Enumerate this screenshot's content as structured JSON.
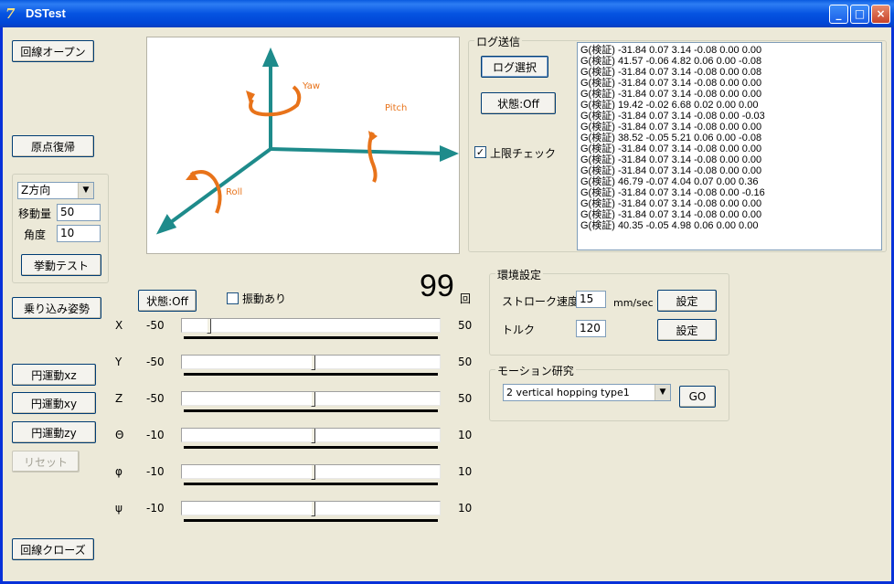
{
  "window": {
    "title": "DSTest",
    "icon_glyph": "7",
    "min": "_",
    "max": "□",
    "close": "×"
  },
  "left": {
    "open_line": "回線オープン",
    "origin_reset": "原点復帰",
    "direction": "Z方向",
    "move_label": "移動量",
    "move_value": "50",
    "angle_label": "角度",
    "angle_value": "10",
    "behavior_test": "挙動テスト",
    "boarding_pose": "乗り込み姿勢",
    "circle_xz": "円運動xz",
    "circle_xy": "円運動xy",
    "circle_zy": "円運動zy",
    "reset": "リセット",
    "close_line": "回線クローズ"
  },
  "axes3d": {
    "yaw": "Yaw",
    "pitch": "Pitch",
    "roll": "Roll"
  },
  "log_panel": {
    "legend": "ログ送信",
    "select_log": "ログ選択",
    "state": "状態:Off",
    "limit_check": "上限チェック",
    "lines": [
      "G(検証) -31.84 0.07 3.14 -0.08 0.00 0.00",
      "G(検証) 41.57 -0.06 4.82 0.06 0.00 -0.08",
      "G(検証) -31.84 0.07 3.14 -0.08 0.00 0.08",
      "G(検証) -31.84 0.07 3.14 -0.08 0.00 0.00",
      "G(検証) -31.84 0.07 3.14 -0.08 0.00 0.00",
      "G(検証) 19.42 -0.02 6.68 0.02 0.00 0.00",
      "G(検証) -31.84 0.07 3.14 -0.08 0.00 -0.03",
      "G(検証) -31.84 0.07 3.14 -0.08 0.00 0.00",
      "G(検証) 38.52 -0.05 5.21 0.06 0.00 -0.08",
      "G(検証) -31.84 0.07 3.14 -0.08 0.00 0.00",
      "G(検証) -31.84 0.07 3.14 -0.08 0.00 0.00",
      "G(検証) -31.84 0.07 3.14 -0.08 0.00 0.00",
      "G(検証) 46.79 -0.07 4.04 0.07 0.00 0.36",
      "G(検証) -31.84 0.07 3.14 -0.08 0.00 -0.16",
      "G(検証) -31.84 0.07 3.14 -0.08 0.00 0.00",
      "G(検証) -31.84 0.07 3.14 -0.08 0.00 0.00",
      "G(検証) 40.35 -0.05 4.98 0.06 0.00 0.00"
    ]
  },
  "controls": {
    "state": "状態:Off",
    "vibration": "振動あり",
    "count": "99",
    "count_unit": "回"
  },
  "sliders": [
    {
      "axis": "X",
      "min": "-50",
      "max": "50",
      "value": -40,
      "lo": -50,
      "hi": 50
    },
    {
      "axis": "Y",
      "min": "-50",
      "max": "50",
      "value": 0,
      "lo": -50,
      "hi": 50
    },
    {
      "axis": "Z",
      "min": "-50",
      "max": "50",
      "value": 0,
      "lo": -50,
      "hi": 50
    },
    {
      "axis": "Θ",
      "min": "-10",
      "max": "10",
      "value": 0,
      "lo": -10,
      "hi": 10
    },
    {
      "axis": "φ",
      "min": "-10",
      "max": "10",
      "value": 0,
      "lo": -10,
      "hi": 10
    },
    {
      "axis": "ψ",
      "min": "-10",
      "max": "10",
      "value": 0,
      "lo": -10,
      "hi": 10
    }
  ],
  "env": {
    "legend": "環境設定",
    "stroke_label": "ストローク速度",
    "stroke_value": "15",
    "stroke_unit": "mm/sec",
    "set1": "設定",
    "torque_label": "トルク",
    "torque_value": "120",
    "set2": "設定"
  },
  "motion": {
    "legend": "モーション研究",
    "selected": "2 vertical hopping type1",
    "go": "GO"
  }
}
